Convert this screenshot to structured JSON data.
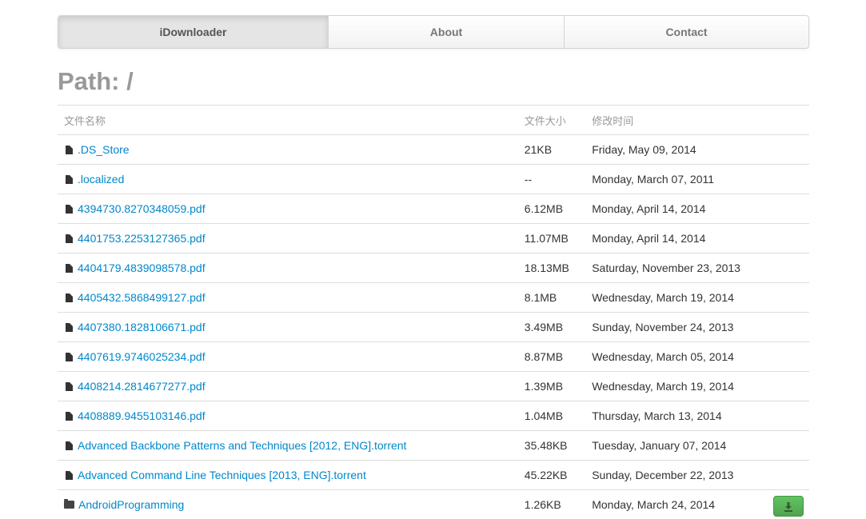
{
  "nav": {
    "items": [
      {
        "label": "iDownloader",
        "active": true
      },
      {
        "label": "About",
        "active": false
      },
      {
        "label": "Contact",
        "active": false
      }
    ]
  },
  "page": {
    "title": "Path: /"
  },
  "table": {
    "headers": {
      "name": "文件名称",
      "size": "文件大小",
      "modified": "修改时间"
    },
    "rows": [
      {
        "type": "file",
        "name": ".DS_Store",
        "size": "21KB",
        "modified": "Friday, May 09, 2014"
      },
      {
        "type": "file",
        "name": ".localized",
        "size": "--",
        "modified": "Monday, March 07, 2011"
      },
      {
        "type": "file",
        "name": "4394730.8270348059.pdf",
        "size": "6.12MB",
        "modified": "Monday, April 14, 2014"
      },
      {
        "type": "file",
        "name": "4401753.2253127365.pdf",
        "size": "11.07MB",
        "modified": "Monday, April 14, 2014"
      },
      {
        "type": "file",
        "name": "4404179.4839098578.pdf",
        "size": "18.13MB",
        "modified": "Saturday, November 23, 2013"
      },
      {
        "type": "file",
        "name": "4405432.5868499127.pdf",
        "size": "8.1MB",
        "modified": "Wednesday, March 19, 2014"
      },
      {
        "type": "file",
        "name": "4407380.1828106671.pdf",
        "size": "3.49MB",
        "modified": "Sunday, November 24, 2013"
      },
      {
        "type": "file",
        "name": "4407619.9746025234.pdf",
        "size": "8.87MB",
        "modified": "Wednesday, March 05, 2014"
      },
      {
        "type": "file",
        "name": "4408214.2814677277.pdf",
        "size": "1.39MB",
        "modified": "Wednesday, March 19, 2014"
      },
      {
        "type": "file",
        "name": "4408889.9455103146.pdf",
        "size": "1.04MB",
        "modified": "Thursday, March 13, 2014"
      },
      {
        "type": "file",
        "name": "Advanced Backbone Patterns and Techniques [2012, ENG].torrent",
        "size": "35.48KB",
        "modified": "Tuesday, January 07, 2014"
      },
      {
        "type": "file",
        "name": "Advanced Command Line Techniques [2013, ENG].torrent",
        "size": "45.22KB",
        "modified": "Sunday, December 22, 2013"
      },
      {
        "type": "folder",
        "name": "AndroidProgramming",
        "size": "1.26KB",
        "modified": "Monday, March 24, 2014",
        "download": true
      }
    ]
  },
  "icons": {
    "file": "file-icon",
    "folder": "folder-open-icon",
    "download": "download-icon"
  },
  "colors": {
    "link": "#0088cc",
    "download_button": "#5bb75b",
    "title": "#999999"
  }
}
